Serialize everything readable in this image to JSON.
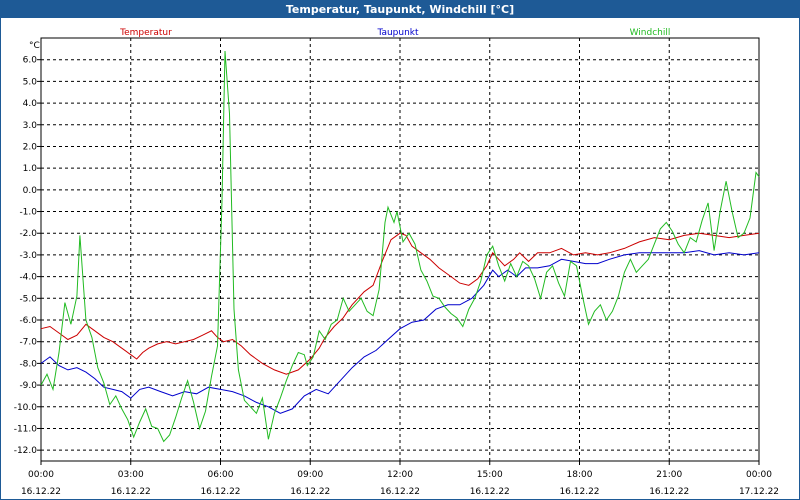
{
  "window": {
    "title": "Temperatur, Taupunkt, Windchill [°C]"
  },
  "colors": {
    "titlebar": "#1e5a96",
    "temperatur": "#cc0000",
    "taupunkt": "#0000cc",
    "windchill": "#22bb22",
    "grid": "#000000"
  },
  "chart_data": {
    "type": "line",
    "title": "Temperatur, Taupunkt, Windchill [°C]",
    "ylabel": "°C",
    "ylim": [
      -12.5,
      7
    ],
    "yticks": [
      6.0,
      5.0,
      4.0,
      3.0,
      2.0,
      1.0,
      0.0,
      -1.0,
      -2.0,
      -3.0,
      -4.0,
      -5.0,
      -6.0,
      -7.0,
      -8.0,
      -9.0,
      -10.0,
      -11.0,
      -12.0
    ],
    "xlim": [
      0,
      24
    ],
    "xticks": [
      {
        "x": 0,
        "time": "00:00",
        "date": "16.12.22"
      },
      {
        "x": 3,
        "time": "03:00",
        "date": "16.12.22"
      },
      {
        "x": 6,
        "time": "06:00",
        "date": "16.12.22"
      },
      {
        "x": 9,
        "time": "09:00",
        "date": "16.12.22"
      },
      {
        "x": 12,
        "time": "12:00",
        "date": "16.12.22"
      },
      {
        "x": 15,
        "time": "15:00",
        "date": "16.12.22"
      },
      {
        "x": 18,
        "time": "18:00",
        "date": "16.12.22"
      },
      {
        "x": 21,
        "time": "21:00",
        "date": "16.12.22"
      },
      {
        "x": 24,
        "time": "00:00",
        "date": "17.12.22"
      }
    ],
    "grid": true,
    "legend_position": "top",
    "series": [
      {
        "name": "Temperatur",
        "color": "#cc0000",
        "points": [
          [
            0,
            -6.4
          ],
          [
            0.3,
            -6.3
          ],
          [
            0.6,
            -6.6
          ],
          [
            0.9,
            -6.9
          ],
          [
            1.2,
            -6.7
          ],
          [
            1.5,
            -6.2
          ],
          [
            1.8,
            -6.5
          ],
          [
            2.1,
            -6.8
          ],
          [
            2.4,
            -7.0
          ],
          [
            2.7,
            -7.3
          ],
          [
            3.0,
            -7.6
          ],
          [
            3.2,
            -7.8
          ],
          [
            3.4,
            -7.5
          ],
          [
            3.6,
            -7.3
          ],
          [
            3.9,
            -7.1
          ],
          [
            4.2,
            -7.0
          ],
          [
            4.5,
            -7.1
          ],
          [
            4.8,
            -7.0
          ],
          [
            5.1,
            -6.9
          ],
          [
            5.4,
            -6.7
          ],
          [
            5.7,
            -6.5
          ],
          [
            5.9,
            -6.8
          ],
          [
            6.1,
            -7.0
          ],
          [
            6.4,
            -6.9
          ],
          [
            6.7,
            -7.2
          ],
          [
            7.0,
            -7.6
          ],
          [
            7.4,
            -8.0
          ],
          [
            7.8,
            -8.3
          ],
          [
            8.2,
            -8.5
          ],
          [
            8.6,
            -8.3
          ],
          [
            9.0,
            -7.8
          ],
          [
            9.3,
            -7.3
          ],
          [
            9.5,
            -6.8
          ],
          [
            9.8,
            -6.3
          ],
          [
            10.1,
            -5.9
          ],
          [
            10.4,
            -5.3
          ],
          [
            10.8,
            -4.7
          ],
          [
            11.1,
            -4.4
          ],
          [
            11.4,
            -3.3
          ],
          [
            11.7,
            -2.3
          ],
          [
            12.0,
            -2.0
          ],
          [
            12.2,
            -2.1
          ],
          [
            12.4,
            -2.6
          ],
          [
            12.7,
            -2.9
          ],
          [
            13.0,
            -3.2
          ],
          [
            13.3,
            -3.6
          ],
          [
            13.6,
            -3.9
          ],
          [
            14.0,
            -4.3
          ],
          [
            14.3,
            -4.4
          ],
          [
            14.6,
            -4.1
          ],
          [
            14.9,
            -3.5
          ],
          [
            15.1,
            -2.9
          ],
          [
            15.3,
            -3.2
          ],
          [
            15.5,
            -3.5
          ],
          [
            15.8,
            -3.2
          ],
          [
            16.0,
            -2.9
          ],
          [
            16.3,
            -3.3
          ],
          [
            16.6,
            -2.9
          ],
          [
            17.0,
            -2.9
          ],
          [
            17.4,
            -2.7
          ],
          [
            17.8,
            -3.0
          ],
          [
            18.2,
            -2.9
          ],
          [
            18.6,
            -3.0
          ],
          [
            19.0,
            -2.9
          ],
          [
            19.5,
            -2.7
          ],
          [
            20.0,
            -2.4
          ],
          [
            20.5,
            -2.2
          ],
          [
            21.0,
            -2.3
          ],
          [
            21.5,
            -2.1
          ],
          [
            22.0,
            -2.0
          ],
          [
            22.5,
            -2.1
          ],
          [
            23.0,
            -2.2
          ],
          [
            23.5,
            -2.1
          ],
          [
            24.0,
            -2.0
          ]
        ]
      },
      {
        "name": "Taupunkt",
        "color": "#0000cc",
        "points": [
          [
            0,
            -8.0
          ],
          [
            0.3,
            -7.7
          ],
          [
            0.6,
            -8.1
          ],
          [
            0.9,
            -8.3
          ],
          [
            1.2,
            -8.2
          ],
          [
            1.5,
            -8.4
          ],
          [
            1.8,
            -8.7
          ],
          [
            2.1,
            -9.1
          ],
          [
            2.4,
            -9.2
          ],
          [
            2.7,
            -9.3
          ],
          [
            3.0,
            -9.6
          ],
          [
            3.3,
            -9.2
          ],
          [
            3.6,
            -9.1
          ],
          [
            4.0,
            -9.3
          ],
          [
            4.4,
            -9.5
          ],
          [
            4.8,
            -9.3
          ],
          [
            5.2,
            -9.4
          ],
          [
            5.6,
            -9.1
          ],
          [
            6.0,
            -9.2
          ],
          [
            6.4,
            -9.3
          ],
          [
            6.8,
            -9.5
          ],
          [
            7.2,
            -9.8
          ],
          [
            7.6,
            -10.0
          ],
          [
            8.0,
            -10.3
          ],
          [
            8.4,
            -10.1
          ],
          [
            8.8,
            -9.5
          ],
          [
            9.2,
            -9.2
          ],
          [
            9.6,
            -9.4
          ],
          [
            10.0,
            -8.8
          ],
          [
            10.4,
            -8.2
          ],
          [
            10.8,
            -7.7
          ],
          [
            11.2,
            -7.4
          ],
          [
            11.6,
            -6.9
          ],
          [
            12.0,
            -6.4
          ],
          [
            12.4,
            -6.1
          ],
          [
            12.8,
            -6.0
          ],
          [
            13.2,
            -5.5
          ],
          [
            13.6,
            -5.3
          ],
          [
            14.0,
            -5.3
          ],
          [
            14.4,
            -5.0
          ],
          [
            14.8,
            -4.4
          ],
          [
            15.1,
            -3.7
          ],
          [
            15.3,
            -4.0
          ],
          [
            15.6,
            -3.7
          ],
          [
            15.9,
            -4.0
          ],
          [
            16.2,
            -3.6
          ],
          [
            16.6,
            -3.6
          ],
          [
            17.0,
            -3.5
          ],
          [
            17.4,
            -3.2
          ],
          [
            17.8,
            -3.3
          ],
          [
            18.2,
            -3.4
          ],
          [
            18.6,
            -3.4
          ],
          [
            19.0,
            -3.2
          ],
          [
            19.5,
            -3.0
          ],
          [
            20.0,
            -2.9
          ],
          [
            20.5,
            -2.9
          ],
          [
            21.0,
            -2.9
          ],
          [
            21.5,
            -2.9
          ],
          [
            22.0,
            -2.8
          ],
          [
            22.5,
            -3.0
          ],
          [
            23.0,
            -2.9
          ],
          [
            23.5,
            -3.0
          ],
          [
            24.0,
            -2.9
          ]
        ]
      },
      {
        "name": "Windchill",
        "color": "#22bb22",
        "points": [
          [
            0,
            -9.0
          ],
          [
            0.2,
            -8.5
          ],
          [
            0.4,
            -9.2
          ],
          [
            0.6,
            -7.5
          ],
          [
            0.8,
            -5.2
          ],
          [
            1.0,
            -6.2
          ],
          [
            1.2,
            -4.9
          ],
          [
            1.3,
            -2.1
          ],
          [
            1.5,
            -6.0
          ],
          [
            1.7,
            -6.8
          ],
          [
            1.9,
            -8.2
          ],
          [
            2.1,
            -8.9
          ],
          [
            2.3,
            -9.9
          ],
          [
            2.5,
            -9.5
          ],
          [
            2.7,
            -10.1
          ],
          [
            2.9,
            -10.6
          ],
          [
            3.1,
            -11.4
          ],
          [
            3.3,
            -10.7
          ],
          [
            3.5,
            -10.1
          ],
          [
            3.7,
            -10.9
          ],
          [
            3.9,
            -11.0
          ],
          [
            4.1,
            -11.6
          ],
          [
            4.3,
            -11.3
          ],
          [
            4.5,
            -10.5
          ],
          [
            4.7,
            -9.6
          ],
          [
            4.9,
            -8.8
          ],
          [
            5.1,
            -9.8
          ],
          [
            5.3,
            -11.0
          ],
          [
            5.5,
            -10.2
          ],
          [
            5.7,
            -8.6
          ],
          [
            5.9,
            -7.2
          ],
          [
            6.05,
            -0.5
          ],
          [
            6.15,
            6.4
          ],
          [
            6.3,
            3.5
          ],
          [
            6.45,
            -5.5
          ],
          [
            6.6,
            -8.3
          ],
          [
            6.8,
            -9.7
          ],
          [
            7.0,
            -10.0
          ],
          [
            7.2,
            -10.3
          ],
          [
            7.4,
            -9.6
          ],
          [
            7.6,
            -11.5
          ],
          [
            7.8,
            -10.3
          ],
          [
            8.0,
            -9.6
          ],
          [
            8.2,
            -8.8
          ],
          [
            8.4,
            -8.1
          ],
          [
            8.6,
            -7.5
          ],
          [
            8.8,
            -7.6
          ],
          [
            8.9,
            -8.1
          ],
          [
            9.1,
            -7.7
          ],
          [
            9.3,
            -6.5
          ],
          [
            9.5,
            -6.9
          ],
          [
            9.7,
            -6.2
          ],
          [
            9.9,
            -6.0
          ],
          [
            10.1,
            -5.0
          ],
          [
            10.3,
            -5.6
          ],
          [
            10.5,
            -5.3
          ],
          [
            10.7,
            -5.0
          ],
          [
            10.9,
            -5.6
          ],
          [
            11.1,
            -5.8
          ],
          [
            11.3,
            -4.6
          ],
          [
            11.5,
            -1.5
          ],
          [
            11.6,
            -0.8
          ],
          [
            11.8,
            -1.5
          ],
          [
            11.9,
            -1.0
          ],
          [
            12.1,
            -2.4
          ],
          [
            12.3,
            -2.0
          ],
          [
            12.5,
            -2.5
          ],
          [
            12.7,
            -3.7
          ],
          [
            12.9,
            -4.2
          ],
          [
            13.1,
            -4.9
          ],
          [
            13.3,
            -5.0
          ],
          [
            13.5,
            -5.4
          ],
          [
            13.7,
            -5.7
          ],
          [
            13.9,
            -5.9
          ],
          [
            14.1,
            -6.3
          ],
          [
            14.3,
            -5.5
          ],
          [
            14.5,
            -5.0
          ],
          [
            14.7,
            -4.2
          ],
          [
            14.9,
            -3.0
          ],
          [
            15.1,
            -2.6
          ],
          [
            15.3,
            -3.5
          ],
          [
            15.5,
            -4.2
          ],
          [
            15.7,
            -3.4
          ],
          [
            15.9,
            -4.0
          ],
          [
            16.1,
            -3.3
          ],
          [
            16.3,
            -3.5
          ],
          [
            16.5,
            -4.1
          ],
          [
            16.7,
            -5.0
          ],
          [
            16.9,
            -3.8
          ],
          [
            17.1,
            -3.5
          ],
          [
            17.3,
            -4.3
          ],
          [
            17.5,
            -4.9
          ],
          [
            17.7,
            -3.3
          ],
          [
            17.9,
            -3.5
          ],
          [
            18.1,
            -4.9
          ],
          [
            18.3,
            -6.2
          ],
          [
            18.5,
            -5.6
          ],
          [
            18.7,
            -5.3
          ],
          [
            18.9,
            -6.0
          ],
          [
            19.1,
            -5.6
          ],
          [
            19.3,
            -4.9
          ],
          [
            19.5,
            -3.8
          ],
          [
            19.7,
            -3.2
          ],
          [
            19.9,
            -3.8
          ],
          [
            20.1,
            -3.5
          ],
          [
            20.3,
            -3.2
          ],
          [
            20.5,
            -2.5
          ],
          [
            20.7,
            -1.8
          ],
          [
            20.9,
            -1.5
          ],
          [
            21.1,
            -1.9
          ],
          [
            21.3,
            -2.5
          ],
          [
            21.5,
            -2.9
          ],
          [
            21.7,
            -2.2
          ],
          [
            21.9,
            -2.4
          ],
          [
            22.1,
            -1.4
          ],
          [
            22.3,
            -0.6
          ],
          [
            22.5,
            -2.8
          ],
          [
            22.7,
            -1.0
          ],
          [
            22.9,
            0.4
          ],
          [
            23.1,
            -1.0
          ],
          [
            23.3,
            -2.2
          ],
          [
            23.5,
            -2.0
          ],
          [
            23.7,
            -1.3
          ],
          [
            23.9,
            0.8
          ],
          [
            24.0,
            0.6
          ]
        ]
      }
    ]
  }
}
